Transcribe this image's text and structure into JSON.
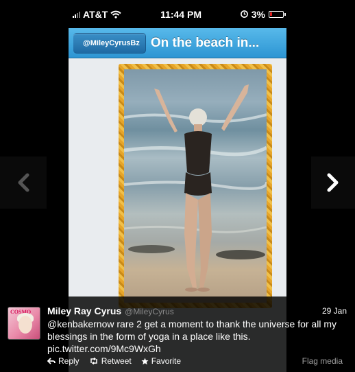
{
  "status_bar": {
    "carrier": "AT&T",
    "time": "11:44 PM",
    "battery": "3%"
  },
  "nav_bar": {
    "back_label": "@MileyCyrusBz",
    "title": "On the beach in..."
  },
  "gallery": {
    "prev_icon": "chevron-left-icon",
    "next_icon": "chevron-right-icon"
  },
  "tweet": {
    "author_name": "Miley Ray Cyrus",
    "author_handle": "@MileyCyrus",
    "date": "29 Jan",
    "text": "@kenbakernow rare 2 get a moment to thank the universe for all my blessings in the form of yoga in a place like this. pic.twitter.com/9Mc9WxGh",
    "avatar_text": "COSMO",
    "actions": {
      "reply": "Reply",
      "retweet": "Retweet",
      "favorite": "Favorite"
    },
    "flag_label": "Flag media"
  },
  "colors": {
    "nav_blue": "#2d95d3",
    "frame_gold": "#e6a52a",
    "battery_red": "#e02020"
  }
}
